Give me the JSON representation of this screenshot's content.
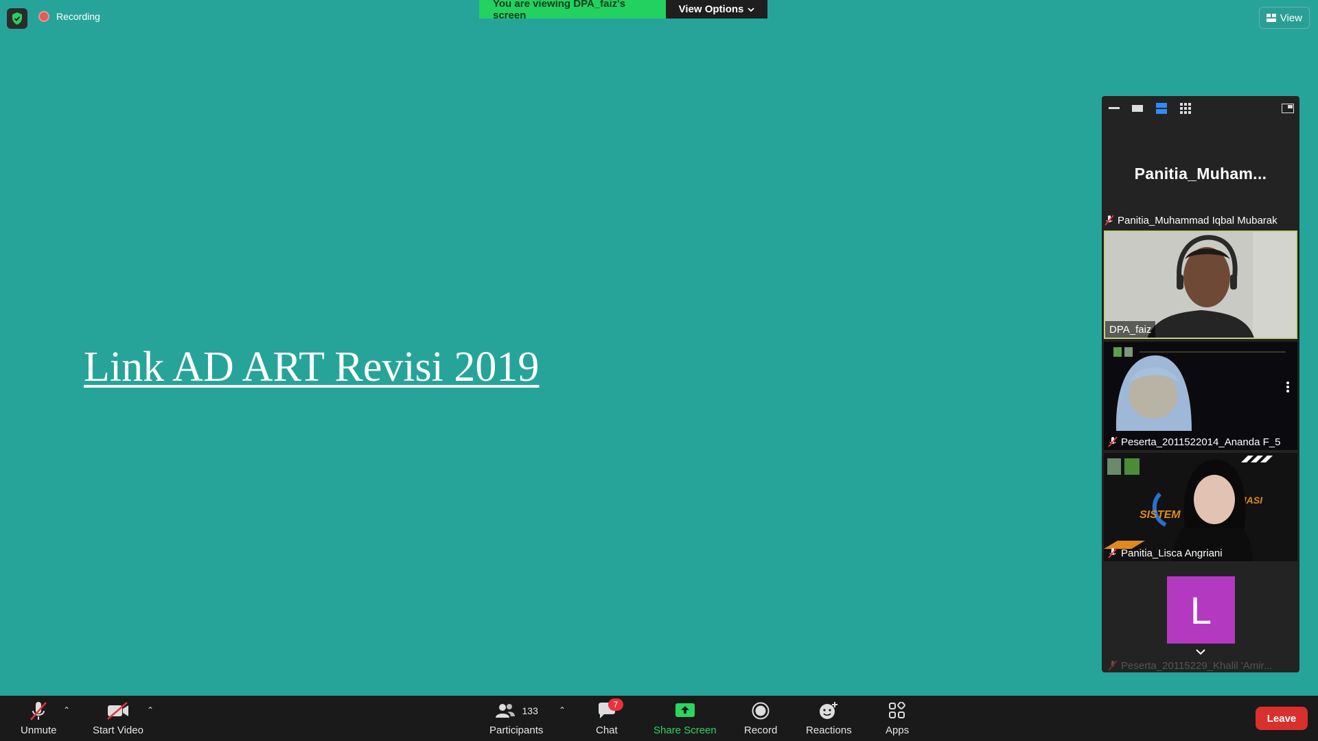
{
  "top": {
    "recording_label": "Recording",
    "banner_text": "You are viewing DPA_faiz's screen",
    "view_options_label": "View Options",
    "view_label": "View"
  },
  "slide": {
    "link_text": "Link AD ART Revisi 2019"
  },
  "panel": {
    "active_speaker": "Panitia_Muham...",
    "active_speaker_fullname": "Panitia_Muhammad Iqbal Mubarak",
    "tiles": [
      {
        "name": "DPA_faiz"
      },
      {
        "name": "Peserta_2011522014_Ananda F_5"
      },
      {
        "name": "Panitia_Lisca Angriani"
      },
      {
        "name": "Peserta_20115229_Khalil 'Amir...",
        "avatar_letter": "L"
      }
    ]
  },
  "toolbar": {
    "unmute": "Unmute",
    "start_video": "Start Video",
    "participants": "Participants",
    "participants_count": "133",
    "chat": "Chat",
    "chat_badge": "7",
    "share_screen": "Share Screen",
    "record": "Record",
    "reactions": "Reactions",
    "apps": "Apps",
    "leave": "Leave"
  },
  "colors": {
    "background": "#27a49a",
    "banner_green": "#23d160",
    "leave_red": "#d9302e",
    "share_green": "#2bd65f",
    "avatar_purple": "#b33ac0"
  }
}
